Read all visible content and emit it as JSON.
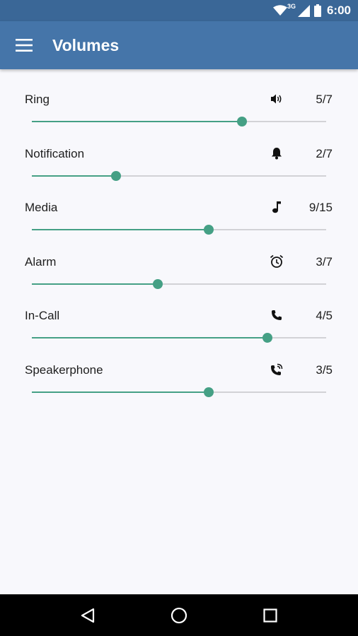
{
  "status_bar": {
    "network_type": "3G",
    "time": "6:00"
  },
  "app_bar": {
    "title": "Volumes",
    "menu_icon": "menu-icon"
  },
  "accent_color": "#45a085",
  "volumes": [
    {
      "label": "Ring",
      "icon": "speaker-icon",
      "value_text": "5/7",
      "level": 5,
      "max": 7
    },
    {
      "label": "Notification",
      "icon": "bell-icon",
      "value_text": "2/7",
      "level": 2,
      "max": 7
    },
    {
      "label": "Media",
      "icon": "music-note-icon",
      "value_text": "9/15",
      "level": 9,
      "max": 15
    },
    {
      "label": "Alarm",
      "icon": "alarm-clock-icon",
      "value_text": "3/7",
      "level": 3,
      "max": 7
    },
    {
      "label": "In-Call",
      "icon": "phone-icon",
      "value_text": "4/5",
      "level": 4,
      "max": 5
    },
    {
      "label": "Speakerphone",
      "icon": "phone-in-talk-icon",
      "value_text": "3/5",
      "level": 3,
      "max": 5
    }
  ],
  "nav_bar": {
    "back_icon": "back-icon",
    "home_icon": "home-icon",
    "recents_icon": "recents-icon"
  }
}
